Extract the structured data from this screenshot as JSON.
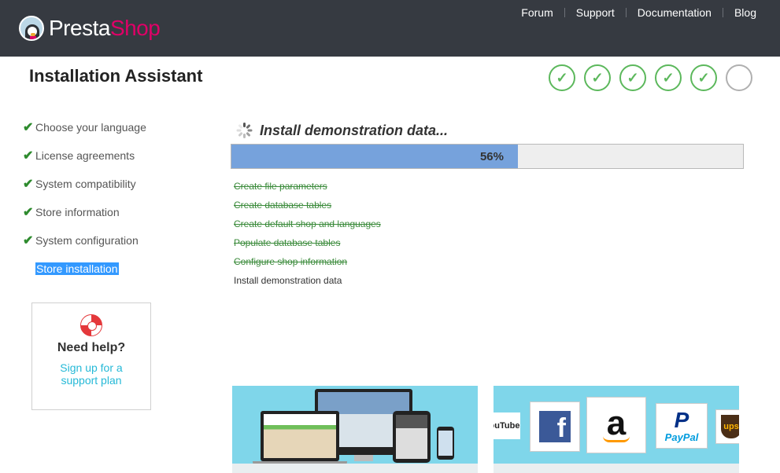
{
  "header": {
    "brand_part1": "Presta",
    "brand_part2": "Shop",
    "nav": [
      {
        "label": "Forum"
      },
      {
        "label": "Support"
      },
      {
        "label": "Documentation"
      },
      {
        "label": "Blog"
      }
    ]
  },
  "page_title": "Installation Assistant",
  "steps": [
    {
      "status": "done"
    },
    {
      "status": "done"
    },
    {
      "status": "done"
    },
    {
      "status": "done"
    },
    {
      "status": "done"
    },
    {
      "status": "pending"
    }
  ],
  "sidebar": {
    "items": [
      {
        "label": "Choose your language",
        "done": true
      },
      {
        "label": "License agreements",
        "done": true
      },
      {
        "label": "System compatibility",
        "done": true
      },
      {
        "label": "Store information",
        "done": true
      },
      {
        "label": "System configuration",
        "done": true
      },
      {
        "label": "Store installation",
        "done": false,
        "current": true
      }
    ],
    "check_glyph": "✔"
  },
  "help": {
    "icon": "lifebuoy-icon",
    "title": "Need help?",
    "link": "Sign up for a support plan"
  },
  "install": {
    "heading": "Install demonstration data...",
    "progress_percent": 56,
    "progress_label": "56%",
    "tasks": [
      {
        "label": "Create file parameters",
        "done": true
      },
      {
        "label": "Create database tables",
        "done": true
      },
      {
        "label": "Create default shop and languages",
        "done": true
      },
      {
        "label": "Populate database tables",
        "done": true
      },
      {
        "label": "Configure shop information",
        "done": true
      },
      {
        "label": "Install demonstration data",
        "done": false
      }
    ]
  },
  "banners": {
    "partners": {
      "youtube": "ouTube",
      "facebook": "f",
      "amazon": "a",
      "paypal_mark": "P",
      "paypal": "PayPal",
      "ups": "ups"
    }
  },
  "colors": {
    "header_bg": "#363a41",
    "brand_accent": "#df0067",
    "success": "#5cb85c",
    "progress_fill": "#76a2dc",
    "link": "#25b9d7"
  }
}
